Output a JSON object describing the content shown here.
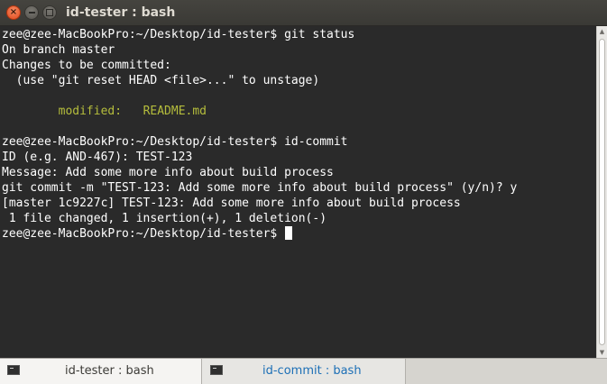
{
  "window": {
    "title": "id-tester : bash"
  },
  "titlebar": {
    "close_glyph": "×",
    "icons": [
      "close-icon",
      "minimize-icon",
      "maximize-icon"
    ]
  },
  "terminal": {
    "lines": [
      "zee@zee-MacBookPro:~/Desktop/id-tester$ git status",
      "On branch master",
      "Changes to be committed:",
      "  (use \"git reset HEAD <file>...\" to unstage)",
      "",
      "",
      "",
      "zee@zee-MacBookPro:~/Desktop/id-tester$ id-commit",
      "ID (e.g. AND-467): TEST-123",
      "Message: Add some more info about build process",
      "git commit -m \"TEST-123: Add some more info about build process\" (y/n)? y",
      "[master 1c9227c] TEST-123: Add some more info about build process",
      " 1 file changed, 1 insertion(+), 1 deletion(-)",
      "zee@zee-MacBookPro:~/Desktop/id-tester$ "
    ],
    "modified_line": {
      "indent": "        ",
      "label": "modified:",
      "gap": "   ",
      "file": "README.md"
    },
    "colors": {
      "background": "#2a2a2a",
      "text": "#ffffff",
      "modified": "#b5bd3c"
    }
  },
  "tabs": [
    {
      "label": "id-tester : bash",
      "active": true,
      "icon": "terminal-icon"
    },
    {
      "label": "id-commit : bash",
      "active": false,
      "icon": "terminal-icon"
    }
  ]
}
